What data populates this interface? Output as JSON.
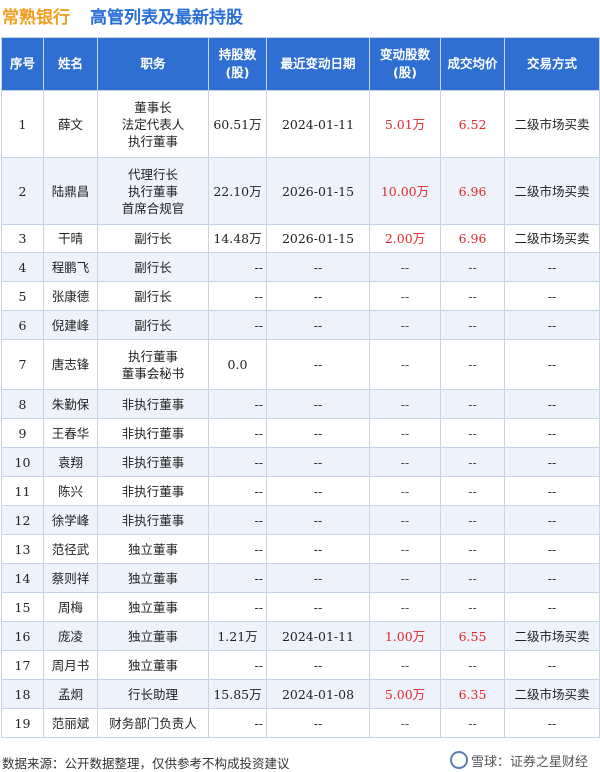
{
  "header": {
    "company": "常熟银行",
    "title": "高管列表及最新持股"
  },
  "columns": [
    "序号",
    "姓名",
    "职务",
    "持股数\n(股)",
    "最近变动日期",
    "变动股数\n(股)",
    "成交均价",
    "交易方式"
  ],
  "rows": [
    {
      "idx": "1",
      "name": "薛文",
      "title": [
        "董事长",
        "法定代表人",
        "执行董事"
      ],
      "shares": "60.51万",
      "date": "2024-01-11",
      "delta": "5.01万",
      "price": "6.52",
      "mode": "二级市场买卖"
    },
    {
      "idx": "2",
      "name": "陆鼎昌",
      "title": [
        "代理行长",
        "执行董事",
        "首席合规官"
      ],
      "shares": "22.10万",
      "date": "2026-01-15",
      "delta": "10.00万",
      "price": "6.96",
      "mode": "二级市场买卖"
    },
    {
      "idx": "3",
      "name": "干晴",
      "title": [
        "副行长"
      ],
      "shares": "14.48万",
      "date": "2026-01-15",
      "delta": "2.00万",
      "price": "6.96",
      "mode": "二级市场买卖"
    },
    {
      "idx": "4",
      "name": "程鹏飞",
      "title": [
        "副行长"
      ],
      "shares": "--",
      "date": "--",
      "delta": "--",
      "price": "--",
      "mode": "--"
    },
    {
      "idx": "5",
      "name": "张康德",
      "title": [
        "副行长"
      ],
      "shares": "--",
      "date": "--",
      "delta": "--",
      "price": "--",
      "mode": "--"
    },
    {
      "idx": "6",
      "name": "倪建峰",
      "title": [
        "副行长"
      ],
      "shares": "--",
      "date": "--",
      "delta": "--",
      "price": "--",
      "mode": "--"
    },
    {
      "idx": "7",
      "name": "唐志锋",
      "title": [
        "执行董事",
        "董事会秘书"
      ],
      "shares": "0.0",
      "date": "--",
      "delta": "--",
      "price": "--",
      "mode": "--"
    },
    {
      "idx": "8",
      "name": "朱勤保",
      "title": [
        "非执行董事"
      ],
      "shares": "--",
      "date": "--",
      "delta": "--",
      "price": "--",
      "mode": "--"
    },
    {
      "idx": "9",
      "name": "王春华",
      "title": [
        "非执行董事"
      ],
      "shares": "--",
      "date": "--",
      "delta": "--",
      "price": "--",
      "mode": "--"
    },
    {
      "idx": "10",
      "name": "袁翔",
      "title": [
        "非执行董事"
      ],
      "shares": "--",
      "date": "--",
      "delta": "--",
      "price": "--",
      "mode": "--"
    },
    {
      "idx": "11",
      "name": "陈兴",
      "title": [
        "非执行董事"
      ],
      "shares": "--",
      "date": "--",
      "delta": "--",
      "price": "--",
      "mode": "--"
    },
    {
      "idx": "12",
      "name": "徐学峰",
      "title": [
        "非执行董事"
      ],
      "shares": "--",
      "date": "--",
      "delta": "--",
      "price": "--",
      "mode": "--"
    },
    {
      "idx": "13",
      "name": "范径武",
      "title": [
        "独立董事"
      ],
      "shares": "--",
      "date": "--",
      "delta": "--",
      "price": "--",
      "mode": "--"
    },
    {
      "idx": "14",
      "name": "蔡则祥",
      "title": [
        "独立董事"
      ],
      "shares": "--",
      "date": "--",
      "delta": "--",
      "price": "--",
      "mode": "--"
    },
    {
      "idx": "15",
      "name": "周梅",
      "title": [
        "独立董事"
      ],
      "shares": "--",
      "date": "--",
      "delta": "--",
      "price": "--",
      "mode": "--"
    },
    {
      "idx": "16",
      "name": "庞凌",
      "title": [
        "独立董事"
      ],
      "shares": "1.21万",
      "date": "2024-01-11",
      "delta": "1.00万",
      "price": "6.55",
      "mode": "二级市场买卖"
    },
    {
      "idx": "17",
      "name": "周月书",
      "title": [
        "独立董事"
      ],
      "shares": "--",
      "date": "--",
      "delta": "--",
      "price": "--",
      "mode": "--"
    },
    {
      "idx": "18",
      "name": "孟炯",
      "title": [
        "行长助理"
      ],
      "shares": "15.85万",
      "date": "2024-01-08",
      "delta": "5.00万",
      "price": "6.35",
      "mode": "二级市场买卖"
    },
    {
      "idx": "19",
      "name": "范丽斌",
      "title": [
        "财务部门负责人"
      ],
      "shares": "--",
      "date": "--",
      "delta": "--",
      "price": "--",
      "mode": "--"
    }
  ],
  "footer": {
    "source": "数据来源：公开数据整理，仅供参考不构成投资建议",
    "brand": "雪球：证券之星财经"
  },
  "colors": {
    "header_bg": "#2f6fd1",
    "title_blue": "#2a6fd6",
    "company_orange": "#f0a020",
    "change_red": "#e0282e",
    "stripe": "#eef3fb"
  }
}
